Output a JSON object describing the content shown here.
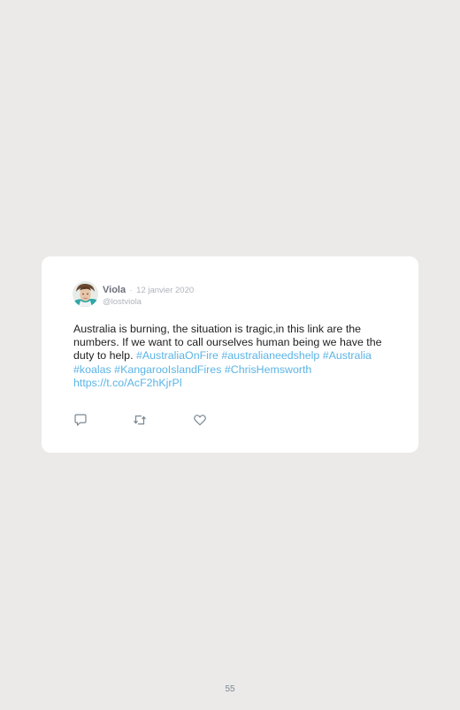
{
  "tweet": {
    "user": {
      "name": "Viola",
      "separator": "·",
      "date": "12 janvier 2020",
      "handle": "@lostviola"
    },
    "text_lines": [
      {
        "type": "text",
        "value": "Australia is burning, the situation is tragic,in this link are the numbers. If we want to call ourselves human being we have the duty to help. "
      },
      {
        "type": "link",
        "value": "#AustraliaOnFire"
      },
      {
        "type": "text",
        "value": " "
      },
      {
        "type": "link",
        "value": "#australianeedshelp"
      },
      {
        "type": "text",
        "value": " "
      },
      {
        "type": "link",
        "value": "#Australia"
      },
      {
        "type": "text",
        "value": " "
      },
      {
        "type": "link",
        "value": "#koalas"
      },
      {
        "type": "text",
        "value": " "
      },
      {
        "type": "link",
        "value": "#KangarooIslandFires"
      },
      {
        "type": "text",
        "value": " "
      },
      {
        "type": "link",
        "value": "#ChrisHemsworth"
      },
      {
        "type": "text",
        "value": " "
      },
      {
        "type": "link",
        "value": "https://t.co/AcF2hKjrPl"
      }
    ],
    "actions": {
      "reply_icon": "reply-icon",
      "retweet_icon": "retweet-icon",
      "like_icon": "heart-icon"
    }
  },
  "page": {
    "number": "55"
  },
  "colors": {
    "background": "#ebeae8",
    "card": "#ffffff",
    "link": "#5bb4e6",
    "muted": "#aeb4bc",
    "icon": "#7a8894"
  }
}
